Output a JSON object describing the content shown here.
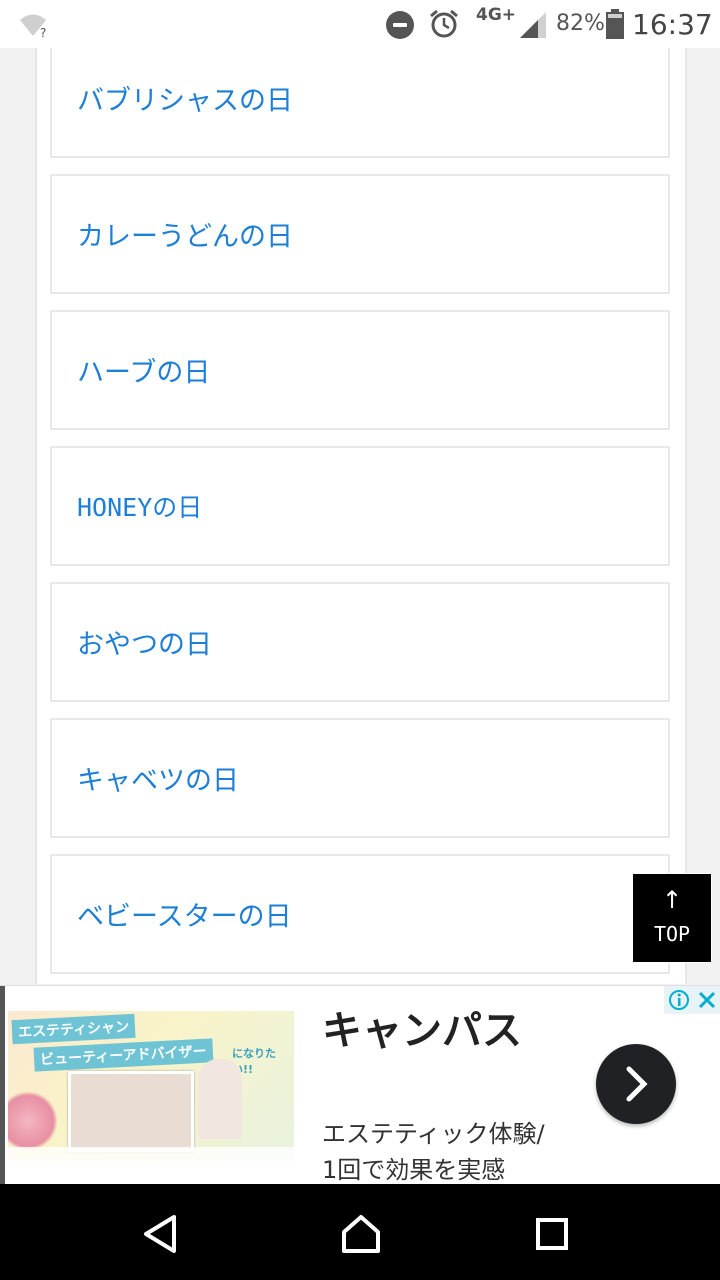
{
  "status_bar": {
    "network": "4G+",
    "battery_percent": "82%",
    "time": "16:37"
  },
  "list": {
    "items": [
      {
        "label": "バブリシャスの日"
      },
      {
        "label": "カレーうどんの日"
      },
      {
        "label": "ハーブの日"
      },
      {
        "label": "HONEYの日"
      },
      {
        "label": "おやつの日"
      },
      {
        "label": "キャベツの日"
      },
      {
        "label": "ベビースターの日"
      }
    ]
  },
  "top_button": {
    "arrow": "↑",
    "label": "TOP"
  },
  "ad": {
    "title": "キャンパス",
    "description_line1": "エステティック体験/",
    "description_line2": "1回で効果を実感",
    "image_text1": "エステティシャン",
    "image_text2": "ビューティーアドバイザー",
    "image_text3": "になりたい!!"
  },
  "colors": {
    "link": "#1e7fd6",
    "card_border": "#e8e8e8"
  }
}
